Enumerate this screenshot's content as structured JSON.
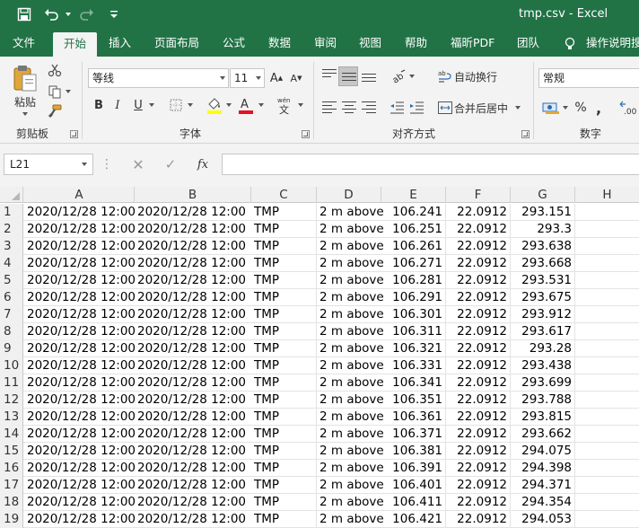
{
  "window": {
    "title": "tmp.csv  -  Excel"
  },
  "tabs": [
    "文件",
    "开始",
    "插入",
    "页面布局",
    "公式",
    "数据",
    "审阅",
    "视图",
    "帮助",
    "福昕PDF",
    "团队",
    "操作说明搜"
  ],
  "ribbon": {
    "clipboard": {
      "paste_label": "粘贴",
      "group_label": "剪贴板"
    },
    "font": {
      "name": "等线",
      "size": "11",
      "bold": "B",
      "italic": "I",
      "underline": "U",
      "group_label": "字体"
    },
    "alignment": {
      "wrap_text": "自动换行",
      "merge_center": "合并后居中",
      "group_label": "对齐方式"
    },
    "number": {
      "format": "常规",
      "percent": "%",
      "group_label": "数字"
    }
  },
  "formula_bar": {
    "cell_ref": "L21",
    "fx": "fx",
    "value": ""
  },
  "sheet": {
    "columns": [
      "A",
      "B",
      "C",
      "D",
      "E",
      "F",
      "G",
      "H"
    ],
    "rows": [
      [
        "1",
        "2020/12/28 12:00",
        "2020/12/28 12:00",
        "TMP",
        "2 m above",
        "106.241",
        "22.0912",
        "293.151"
      ],
      [
        "2",
        "2020/12/28 12:00",
        "2020/12/28 12:00",
        "TMP",
        "2 m above",
        "106.251",
        "22.0912",
        "293.3"
      ],
      [
        "3",
        "2020/12/28 12:00",
        "2020/12/28 12:00",
        "TMP",
        "2 m above",
        "106.261",
        "22.0912",
        "293.638"
      ],
      [
        "4",
        "2020/12/28 12:00",
        "2020/12/28 12:00",
        "TMP",
        "2 m above",
        "106.271",
        "22.0912",
        "293.668"
      ],
      [
        "5",
        "2020/12/28 12:00",
        "2020/12/28 12:00",
        "TMP",
        "2 m above",
        "106.281",
        "22.0912",
        "293.531"
      ],
      [
        "6",
        "2020/12/28 12:00",
        "2020/12/28 12:00",
        "TMP",
        "2 m above",
        "106.291",
        "22.0912",
        "293.675"
      ],
      [
        "7",
        "2020/12/28 12:00",
        "2020/12/28 12:00",
        "TMP",
        "2 m above",
        "106.301",
        "22.0912",
        "293.912"
      ],
      [
        "8",
        "2020/12/28 12:00",
        "2020/12/28 12:00",
        "TMP",
        "2 m above",
        "106.311",
        "22.0912",
        "293.617"
      ],
      [
        "9",
        "2020/12/28 12:00",
        "2020/12/28 12:00",
        "TMP",
        "2 m above",
        "106.321",
        "22.0912",
        "293.28"
      ],
      [
        "10",
        "2020/12/28 12:00",
        "2020/12/28 12:00",
        "TMP",
        "2 m above",
        "106.331",
        "22.0912",
        "293.438"
      ],
      [
        "11",
        "2020/12/28 12:00",
        "2020/12/28 12:00",
        "TMP",
        "2 m above",
        "106.341",
        "22.0912",
        "293.699"
      ],
      [
        "12",
        "2020/12/28 12:00",
        "2020/12/28 12:00",
        "TMP",
        "2 m above",
        "106.351",
        "22.0912",
        "293.788"
      ],
      [
        "13",
        "2020/12/28 12:00",
        "2020/12/28 12:00",
        "TMP",
        "2 m above",
        "106.361",
        "22.0912",
        "293.815"
      ],
      [
        "14",
        "2020/12/28 12:00",
        "2020/12/28 12:00",
        "TMP",
        "2 m above",
        "106.371",
        "22.0912",
        "293.662"
      ],
      [
        "15",
        "2020/12/28 12:00",
        "2020/12/28 12:00",
        "TMP",
        "2 m above",
        "106.381",
        "22.0912",
        "294.075"
      ],
      [
        "16",
        "2020/12/28 12:00",
        "2020/12/28 12:00",
        "TMP",
        "2 m above",
        "106.391",
        "22.0912",
        "294.398"
      ],
      [
        "17",
        "2020/12/28 12:00",
        "2020/12/28 12:00",
        "TMP",
        "2 m above",
        "106.401",
        "22.0912",
        "294.371"
      ],
      [
        "18",
        "2020/12/28 12:00",
        "2020/12/28 12:00",
        "TMP",
        "2 m above",
        "106.411",
        "22.0912",
        "294.354"
      ],
      [
        "19",
        "2020/12/28 12:00",
        "2020/12/28 12:00",
        "TMP",
        "2 m above",
        "106.421",
        "22.0912",
        "294.053"
      ]
    ]
  },
  "colors": {
    "excel_green": "#217346",
    "ribbon_bg": "#f3f3f3"
  }
}
